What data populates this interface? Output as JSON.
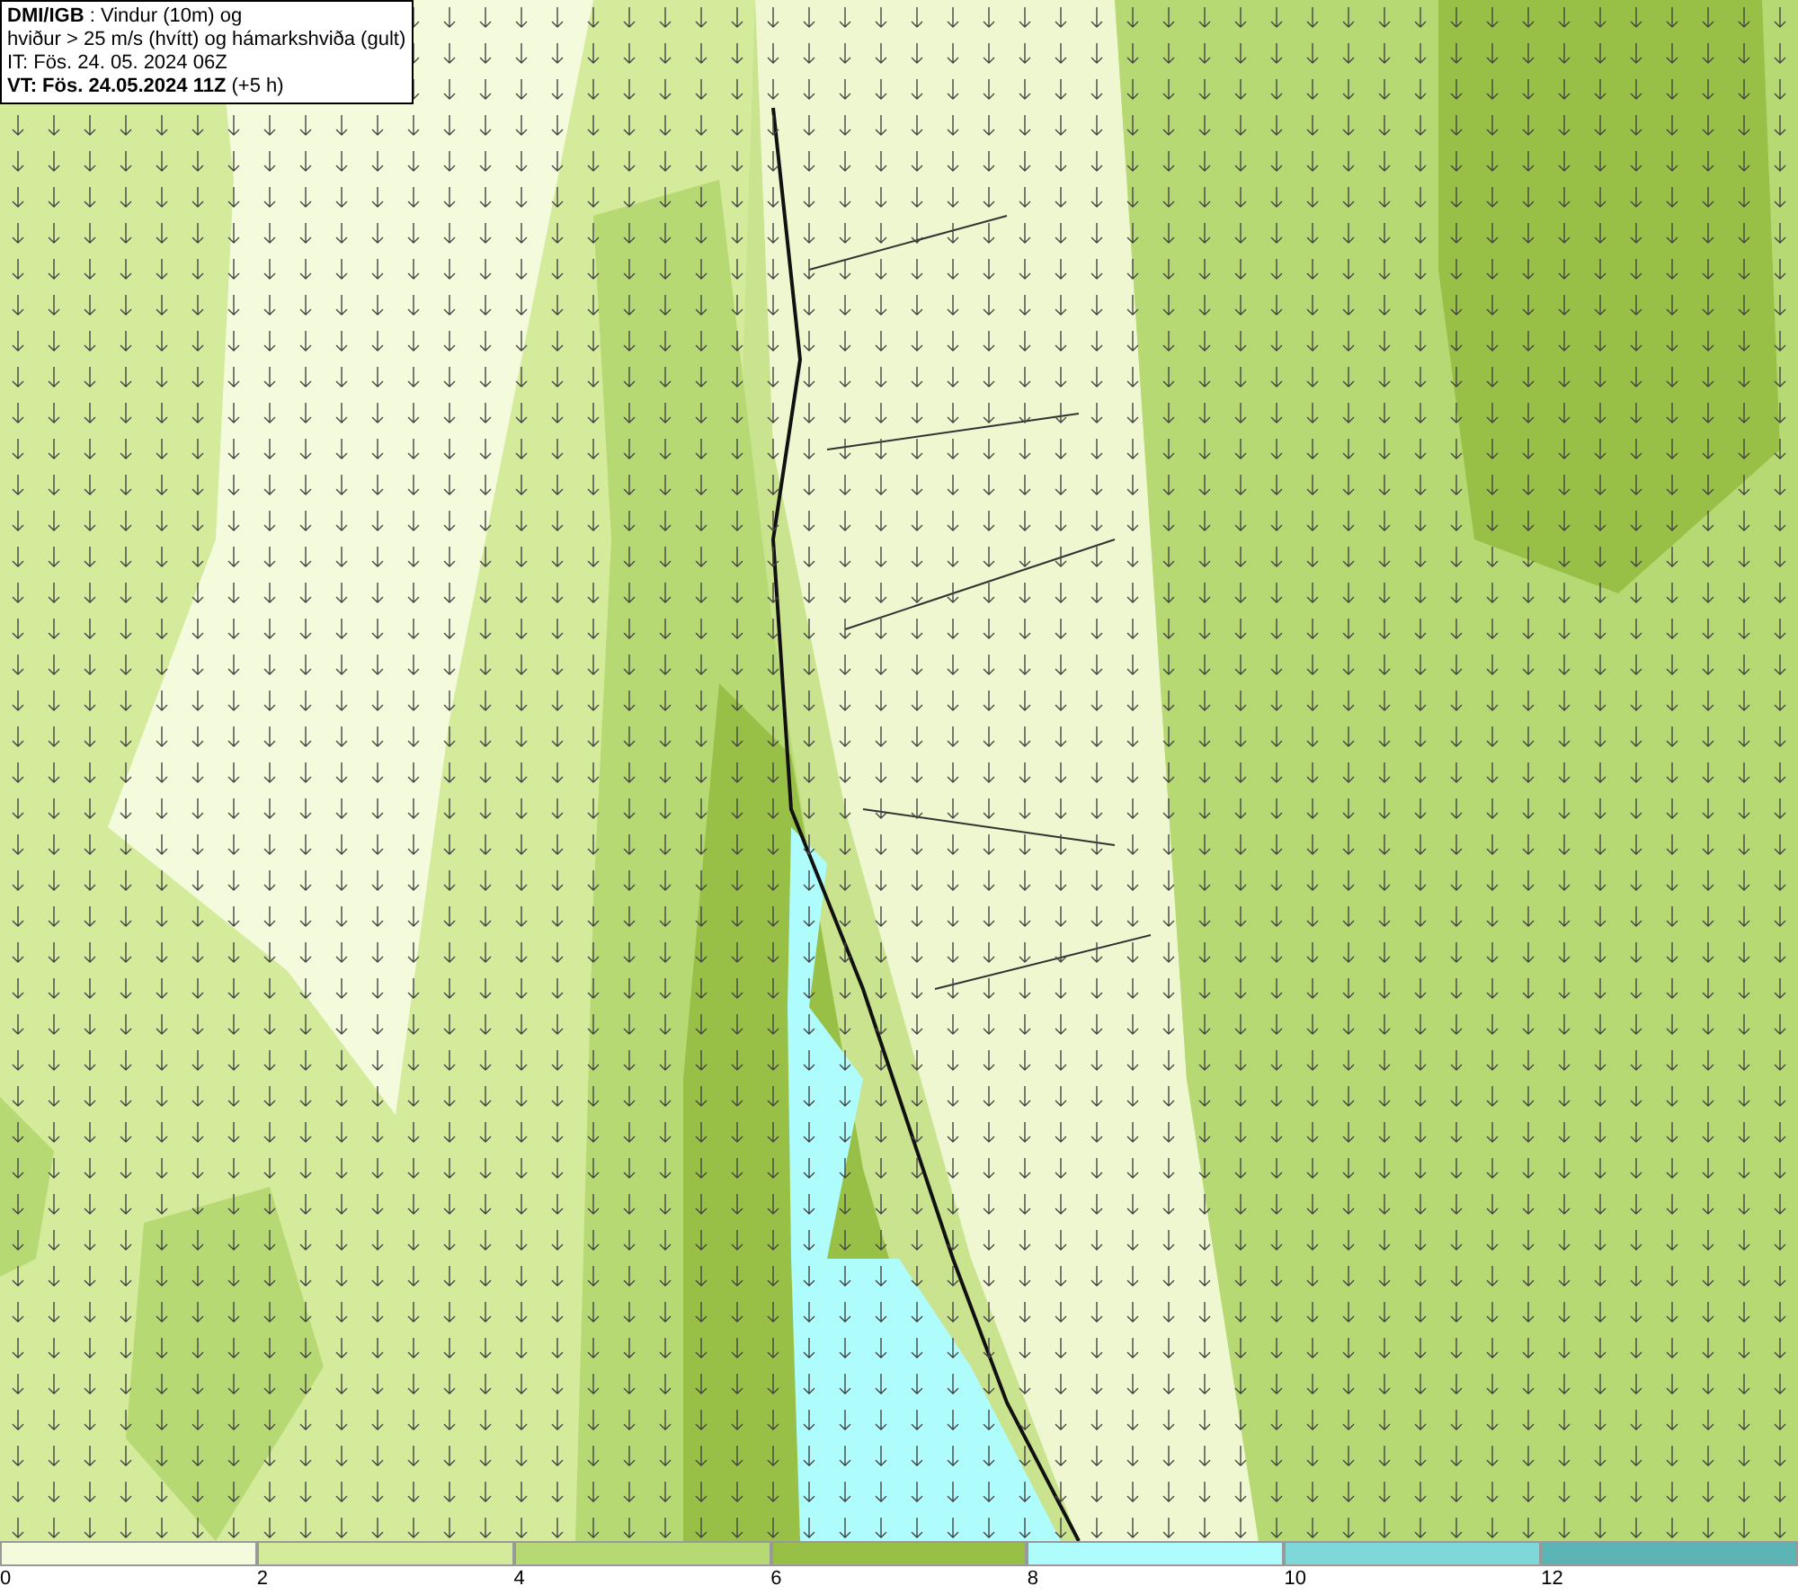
{
  "info_box": {
    "lines": [
      "**DMI/IGB** : Vindur (10m) og",
      "hviður > 25 m/s (hvítt) og hámarkshviða (gult)",
      "IT: Fös. 24. 05. 2024 06Z",
      "**VT: Fös. 24.05.2024 11Z** (+5 h)"
    ]
  },
  "legend": [
    {
      "label": "0",
      "color": "#f4fbdc"
    },
    {
      "label": "2",
      "color": "#d4eb9c"
    },
    {
      "label": "4",
      "color": "#b7d974"
    },
    {
      "label": "6",
      "color": "#98bf46"
    },
    {
      "label": "8",
      "color": "#aefcfc"
    },
    {
      "label": "10",
      "color": "#7fd8d8"
    },
    {
      "label": "12",
      "color": "#5cb4b4"
    }
  ]
}
